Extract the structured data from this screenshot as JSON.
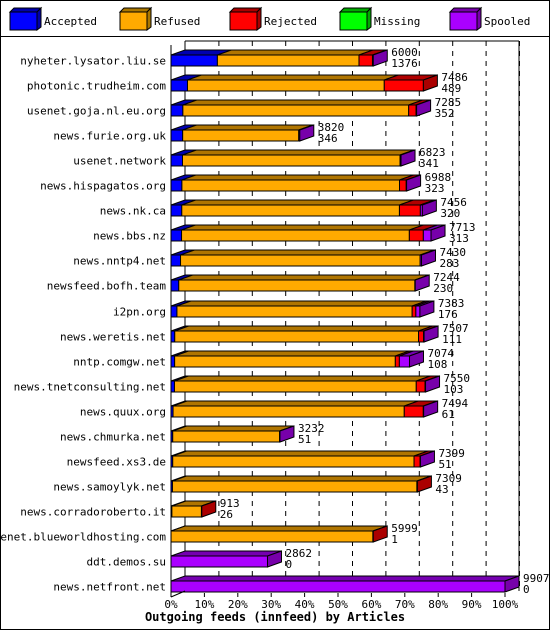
{
  "chart_data": {
    "type": "bar",
    "orientation": "horizontal",
    "stacked": true,
    "three_d": true,
    "title": "",
    "xlabel": "Outgoing feeds (innfeed) by Articles",
    "ylabel": "",
    "xlim": [
      0,
      100
    ],
    "x_ticks": [
      "0%",
      "10%",
      "20%",
      "30%",
      "40%",
      "50%",
      "60%",
      "70%",
      "80%",
      "90%",
      "100%"
    ],
    "grid": "vertical dashed",
    "legend_placement": "top",
    "legend": [
      {
        "key": "accepted",
        "label": "Accepted",
        "color": "#0000ff",
        "shade": "#0000aa"
      },
      {
        "key": "refused",
        "label": "Refused",
        "color": "#ffaa00",
        "shade": "#aa7700"
      },
      {
        "key": "rejected",
        "label": "Rejected",
        "color": "#ff0000",
        "shade": "#aa0000"
      },
      {
        "key": "missing",
        "label": "Missing",
        "color": "#00ff00",
        "shade": "#00aa00"
      },
      {
        "key": "spooled",
        "label": "Spooled",
        "color": "#aa00ff",
        "shade": "#7700aa"
      }
    ],
    "rows": [
      {
        "label": "nyheter.lysator.liu.se",
        "total": 6000,
        "accepted": 1376,
        "refused": 4200,
        "rejected": 400,
        "missing": 0,
        "spooled": 24
      },
      {
        "label": "photonic.trudheim.com",
        "total": 7486,
        "accepted": 489,
        "refused": 5837,
        "rejected": 1160,
        "missing": 0,
        "spooled": 0
      },
      {
        "label": "usenet.goja.nl.eu.org",
        "total": 7285,
        "accepted": 352,
        "refused": 6698,
        "rejected": 220,
        "missing": 0,
        "spooled": 15
      },
      {
        "label": "news.furie.org.uk",
        "total": 3820,
        "accepted": 346,
        "refused": 3444,
        "rejected": 0,
        "missing": 0,
        "spooled": 30
      },
      {
        "label": "usenet.network",
        "total": 6823,
        "accepted": 341,
        "refused": 6452,
        "rejected": 0,
        "missing": 0,
        "spooled": 30
      },
      {
        "label": "news.hispagatos.org",
        "total": 6988,
        "accepted": 323,
        "refused": 6455,
        "rejected": 200,
        "missing": 0,
        "spooled": 10
      },
      {
        "label": "news.nk.ca",
        "total": 7456,
        "accepted": 320,
        "refused": 6456,
        "rejected": 620,
        "missing": 0,
        "spooled": 60
      },
      {
        "label": "news.bbs.nz",
        "total": 7713,
        "accepted": 313,
        "refused": 6757,
        "rejected": 415,
        "missing": 0,
        "spooled": 228
      },
      {
        "label": "news.nntp4.net",
        "total": 7430,
        "accepted": 283,
        "refused": 7107,
        "rejected": 0,
        "missing": 0,
        "spooled": 40
      },
      {
        "label": "newsfeed.bofh.team",
        "total": 7244,
        "accepted": 230,
        "refused": 7004,
        "rejected": 0,
        "missing": 0,
        "spooled": 10
      },
      {
        "label": "i2pn.org",
        "total": 7383,
        "accepted": 176,
        "refused": 6977,
        "rejected": 110,
        "missing": 0,
        "spooled": 120
      },
      {
        "label": "news.weretis.net",
        "total": 7507,
        "accepted": 111,
        "refused": 7231,
        "rejected": 150,
        "missing": 0,
        "spooled": 15
      },
      {
        "label": "nntp.comgw.net",
        "total": 7074,
        "accepted": 108,
        "refused": 6546,
        "rejected": 120,
        "missing": 0,
        "spooled": 300
      },
      {
        "label": "news.tnetconsulting.net",
        "total": 7550,
        "accepted": 103,
        "refused": 7172,
        "rejected": 260,
        "missing": 0,
        "spooled": 15
      },
      {
        "label": "news.quux.org",
        "total": 7494,
        "accepted": 61,
        "refused": 6858,
        "rejected": 565,
        "missing": 0,
        "spooled": 10
      },
      {
        "label": "news.chmurka.net",
        "total": 3232,
        "accepted": 51,
        "refused": 3171,
        "rejected": 0,
        "missing": 0,
        "spooled": 10
      },
      {
        "label": "newsfeed.xs3.de",
        "total": 7399,
        "accepted": 51,
        "refused": 7158,
        "rejected": 180,
        "missing": 0,
        "spooled": 10
      },
      {
        "label": "news.samoylyk.net",
        "total": 7309,
        "accepted": 43,
        "refused": 7251,
        "rejected": 15,
        "missing": 0,
        "spooled": 0
      },
      {
        "label": "news.corradoroberto.it",
        "total": 913,
        "accepted": 26,
        "refused": 877,
        "rejected": 10,
        "missing": 0,
        "spooled": 0
      },
      {
        "label": "usenet.blueworldhosting.com",
        "total": 5999,
        "accepted": 1,
        "refused": 5988,
        "rejected": 10,
        "missing": 0,
        "spooled": 0
      },
      {
        "label": "ddt.demos.su",
        "total": 2862,
        "accepted": 0,
        "refused": 0,
        "rejected": 0,
        "missing": 0,
        "spooled": 2862
      },
      {
        "label": "news.netfront.net",
        "total": 9907,
        "accepted": 0,
        "refused": 0,
        "rejected": 0,
        "missing": 0,
        "spooled": 9907
      }
    ]
  }
}
